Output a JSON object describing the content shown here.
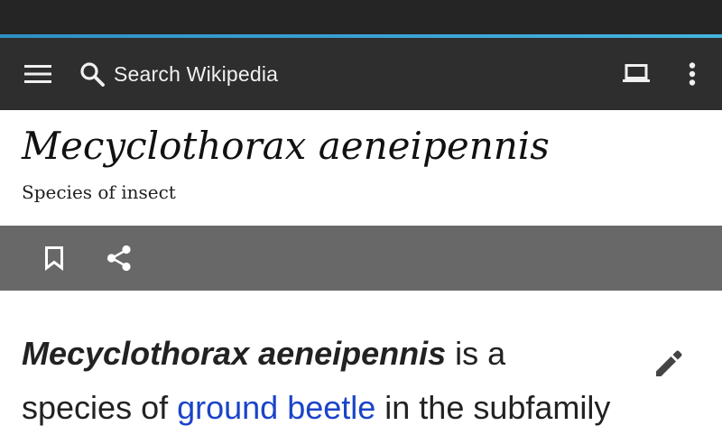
{
  "toolbar": {
    "search_placeholder": "Search Wikipedia",
    "icons": [
      "menu-icon",
      "search-icon",
      "tabs-icon",
      "overflow-icon"
    ]
  },
  "article": {
    "title": "Mecyclothorax aeneipennis",
    "description": "Species of insect",
    "actions": [
      "bookmark-icon",
      "share-icon"
    ],
    "lead": {
      "bold_name": "Mecyclothorax aeneipennis",
      "text_1": " is a species of ",
      "link": "ground beetle",
      "text_2": " in the subfamily"
    },
    "edit_icon": "pencil-icon"
  },
  "colors": {
    "status_bar": "#252525",
    "accent": "#3ea7d8",
    "toolbar": "#2e2e2e",
    "action_bar": "#686868",
    "link": "#1a44c8"
  }
}
